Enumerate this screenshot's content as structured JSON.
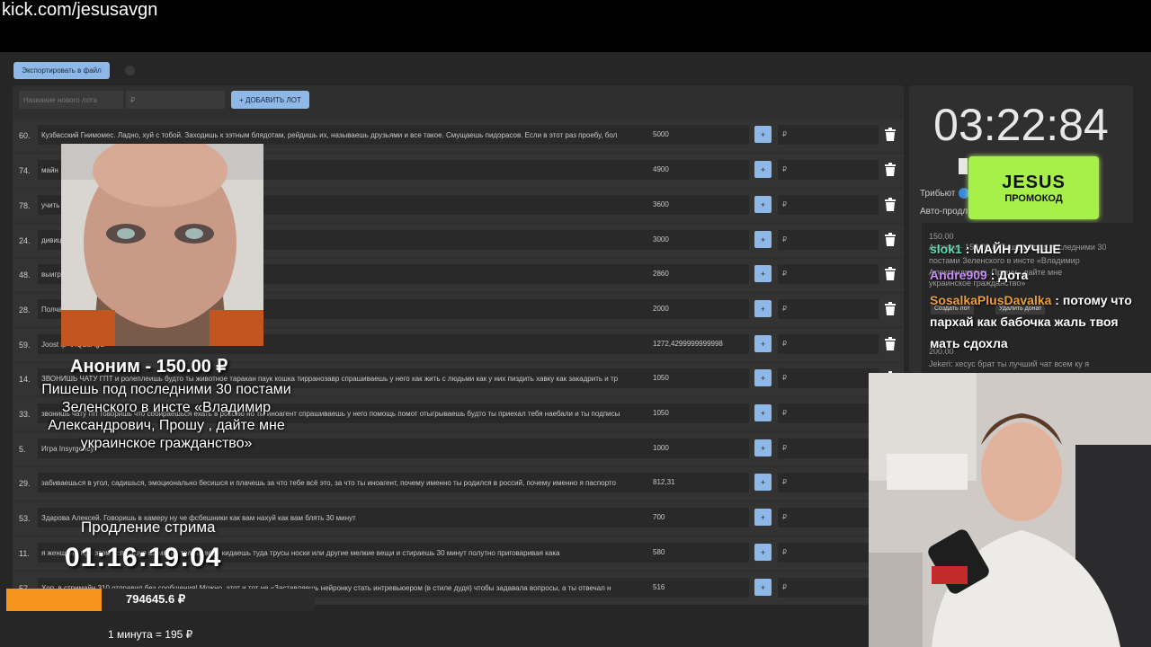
{
  "url": "kick.com/jesusavgn",
  "toolbar": {
    "export_label": "Экспортировать в файл"
  },
  "new_lot": {
    "name_placeholder": "Название нового лота",
    "price_placeholder": "₽",
    "add_label": "+ ДОБАВИТЬ ЛОТ"
  },
  "lots": [
    {
      "num": "60.",
      "name": "Кузбасский Гнимомес. Ладно, хуй с тобой. Заходишь к зэтным блядотам, рейдишь их, называешь друзьями и все такое. Смущаешь пидорасов. Если в этот раз проебу, бол",
      "amount": "5000",
      "plus": "+",
      "rub": "₽"
    },
    {
      "num": "74.",
      "name": "майн",
      "amount": "4900",
      "plus": "+",
      "rub": "₽"
    },
    {
      "num": "78.",
      "name": "учить",
      "amount": "3600",
      "plus": "+",
      "rub": "₽"
    },
    {
      "num": "24.",
      "name": "дивиц",
      "amount": "3000",
      "plus": "+",
      "rub": "₽"
    },
    {
      "num": "48.",
      "name": "выигр",
      "amount": "2860",
      "plus": "+",
      "rub": "₽"
    },
    {
      "num": "28.",
      "name": "Полча                                                                                          ты",
      "amount": "2000",
      "plus": "+",
      "rub": "₽"
    },
    {
      "num": "59.",
      "name": "Joost                                                                                  ip=iAQBsAgC",
      "amount": "1272,4299999999998",
      "plus": "+",
      "rub": "₽"
    },
    {
      "num": "14.",
      "name": "ЗВОНИШЬ ЧАТУ ГПТ и ролеплеишь будто ты животное таракан паук кошка тирранозавр спрашиваешь у него как жить с людьми как у них пиздить хавку как закадрить и тр",
      "amount": "1050",
      "plus": "+",
      "rub": "₽"
    },
    {
      "num": "33.",
      "name": "звонишь чату гпт говоришь что собираешься ехать в россию но ты иноагент спрашиваешь у него помощь помот отыгрываешь будто ты приехал тебя наебали и ты подписы",
      "amount": "1050",
      "plus": "+",
      "rub": "₽"
    },
    {
      "num": "5.",
      "name": "Игра Insyrgency",
      "amount": "1000",
      "plus": "+",
      "rub": "₽"
    },
    {
      "num": "29.",
      "name": "забиваешься в угол, садишься, эмоционально бесишся и плачешь за что тебе всё это, за что ты иноагент, почему именно ты родился в россий, почему именно я паспорто",
      "amount": "812,31",
      "plus": "+",
      "rub": "₽"
    },
    {
      "num": "53.",
      "name": "Здарова Алексей. Говоришь в камеру ну че фсбешники как вам нахуй как вам блять 30 минут",
      "amount": "700",
      "plus": "+",
      "rub": "₽"
    },
    {
      "num": "11.",
      "name": "я женщину, при этом используя шампунь только воду кидаешь туда трусы носки или другие мелкие вещи и стираешь 30 минут полутно приговаривая кака",
      "amount": "580",
      "plus": "+",
      "rub": "₽"
    },
    {
      "num": "57.",
      "name": "Хоп, в стримайн 310 отправил без сообщения! Можно, этот и тот не «Заставляешь нейронку стать интревьюером (в стиле дудя) чтобы задавала вопросы, а ты отвечал н",
      "amount": "516",
      "plus": "+",
      "rub": "₽"
    }
  ],
  "timer": {
    "value": "03:22:84"
  },
  "promo": {
    "line1": "JESUS",
    "line2": "ПРОМОКОД"
  },
  "settings": {
    "tribute_label": "Трибьют",
    "auto_label": "Авто-продл"
  },
  "chat": {
    "bg_lines": [
      "150.00",
      "Аноним - 150.00 ₽ Пишешь под последними 30",
      "постами Зеленского в инсте «Владимир",
      "Александрович, Прошу , дайте мне",
      "украинское гражданство»",
      "200.00",
      "Jekeri: хесус брат ты лучший чат всем ку я"
    ],
    "btn_create": "Создать лот",
    "btn_delete": "Удалить донат",
    "messages": [
      {
        "user": "slok1",
        "text": " : МАЙН ЛУЧШЕ"
      },
      {
        "user": "Andre909",
        "text": " : Дота"
      },
      {
        "user": "SosalkaPlusDavalka",
        "text": " : потому что"
      },
      {
        "user": "",
        "text": "пархай как бабочка жаль твоя"
      },
      {
        "user": "",
        "text": "мать сдохла"
      }
    ]
  },
  "donation": {
    "donor": "Аноним - 150.00 ₽",
    "message": "Пишешь под последними 30 постами Зеленского в инсте «Владимир Александрович, Прошу , дайте мне украинское гражданство»"
  },
  "extension": {
    "label": "Продление стрима",
    "timer": "01:16:19:04"
  },
  "money": {
    "total": "794645.6 ₽",
    "progress": 0.31,
    "rate": "1 минута = 195 ₽"
  },
  "colors": {
    "accent": "#8db8e8",
    "promo": "#a7f04a",
    "progress": "#f7941d"
  }
}
